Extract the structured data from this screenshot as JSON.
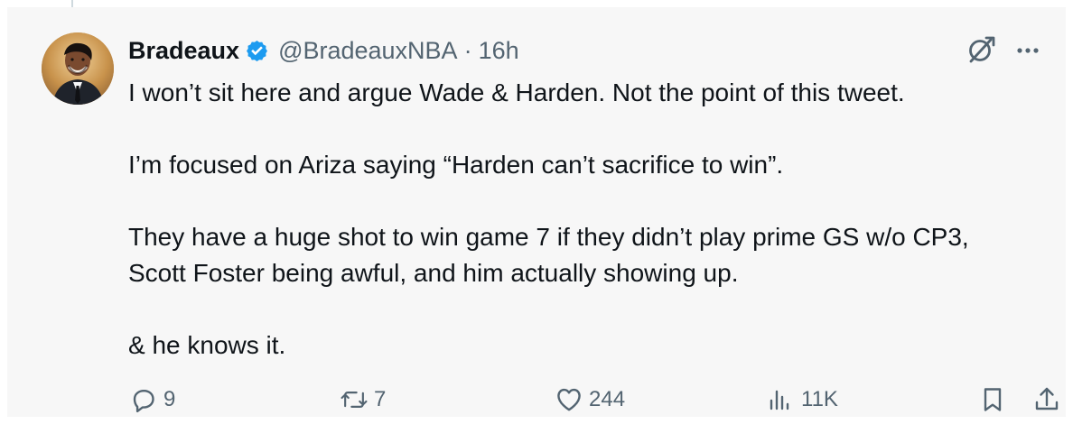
{
  "post": {
    "author": {
      "display_name": "Bradeaux",
      "handle": "@BradeauxNBA",
      "separator": "·",
      "time": "16h"
    },
    "body_lines": [
      "I won’t sit here and argue Wade & Harden. Not the point of this tweet.",
      "I’m focused on Ariza saying “Harden can’t sacrifice to win”.",
      "They have a huge shot to win game 7 if they didn’t play prime GS w/o CP3,",
      "Scott Foster being awful, and him actually showing up.",
      "& he knows it."
    ],
    "actions": {
      "replies": "9",
      "reposts": "7",
      "likes": "244",
      "views": "11K"
    }
  },
  "icons": {
    "avatar": "avatar",
    "verified": "verified-badge-icon",
    "grok": "grok-icon",
    "more": "more-icon",
    "reply": "reply-icon",
    "repost": "repost-icon",
    "like": "heart-icon",
    "views": "views-icon",
    "bookmark": "bookmark-icon",
    "share": "share-icon"
  },
  "colors": {
    "background": "#f7f7f7",
    "text": "#0f1419",
    "secondary_text": "#536471",
    "verified": "#1d9bf0"
  }
}
